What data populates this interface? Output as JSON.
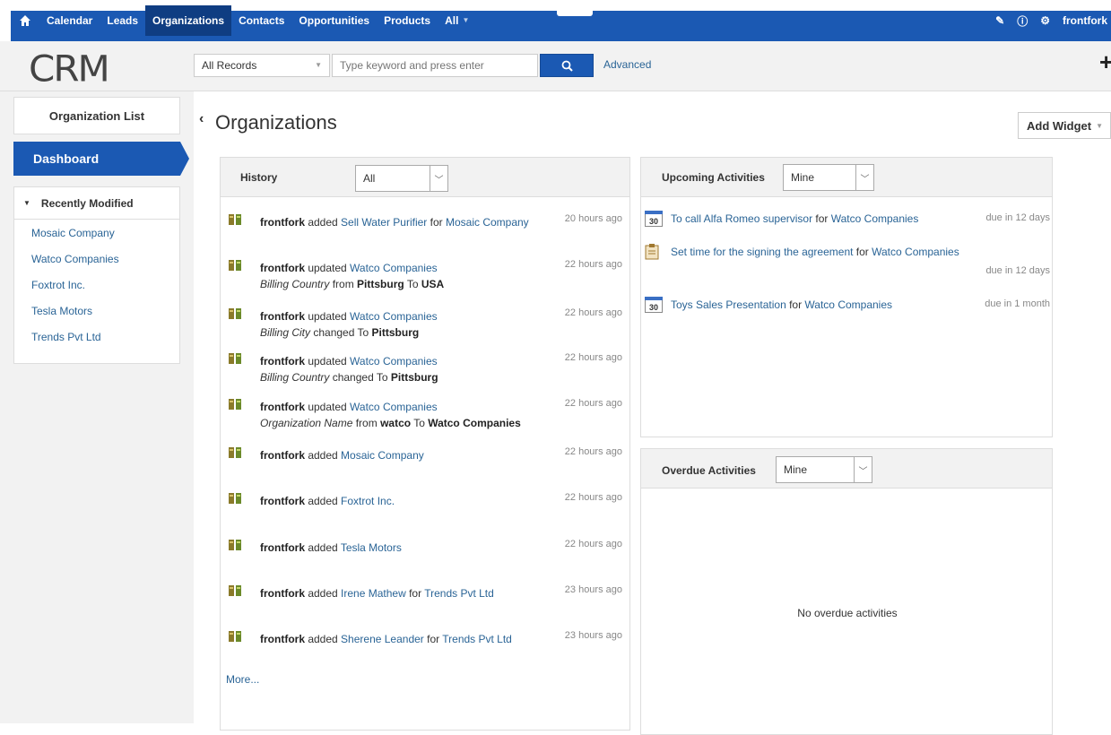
{
  "nav": {
    "items": [
      "Calendar",
      "Leads",
      "Organizations",
      "Contacts",
      "Opportunities",
      "Products",
      "All"
    ],
    "active": "Organizations",
    "user": "frontfork"
  },
  "header": {
    "logo": "CRM",
    "records_select": "All Records",
    "search_placeholder": "Type keyword and press enter",
    "advanced": "Advanced"
  },
  "sidebar": {
    "org_list": "Organization List",
    "dashboard": "Dashboard",
    "recent_title": "Recently Modified",
    "recent_items": [
      "Mosaic Company",
      "Watco Companies",
      "Foxtrot Inc.",
      "Tesla Motors",
      "Trends Pvt Ltd"
    ]
  },
  "page": {
    "title": "Organizations",
    "add_widget": "Add Widget"
  },
  "history": {
    "title": "History",
    "filter": "All",
    "more": "More...",
    "rows": [
      {
        "user": "frontfork",
        "action": "added",
        "link": "Sell Water Purifier",
        "for": "for",
        "target": "Mosaic Company",
        "time": "20 hours ago"
      },
      {
        "user": "frontfork",
        "action": "updated",
        "link": "Watco Companies",
        "field": "Billing Country",
        "mid": "from",
        "from": "Pittsburg",
        "to_word": "To",
        "to": "USA",
        "time": "22 hours ago"
      },
      {
        "user": "frontfork",
        "action": "updated",
        "link": "Watco Companies",
        "field": "Billing City",
        "mid": "changed To",
        "to": "Pittsburg",
        "time": "22 hours ago"
      },
      {
        "user": "frontfork",
        "action": "updated",
        "link": "Watco Companies",
        "field": "Billing Country",
        "mid": "changed To",
        "to": "Pittsburg",
        "time": "22 hours ago"
      },
      {
        "user": "frontfork",
        "action": "updated",
        "link": "Watco Companies",
        "field": "Organization Name",
        "mid": "from",
        "from": "watco",
        "to_word": "To",
        "to": "Watco Companies",
        "time": "22 hours ago"
      },
      {
        "user": "frontfork",
        "action": "added",
        "link": "Mosaic Company",
        "time": "22 hours ago"
      },
      {
        "user": "frontfork",
        "action": "added",
        "link": "Foxtrot Inc.",
        "time": "22 hours ago"
      },
      {
        "user": "frontfork",
        "action": "added",
        "link": "Tesla Motors",
        "time": "22 hours ago"
      },
      {
        "user": "frontfork",
        "action": "added",
        "link": "Irene Mathew",
        "for": "for",
        "target": "Trends Pvt Ltd",
        "time": "23 hours ago"
      },
      {
        "user": "frontfork",
        "action": "added",
        "link": "Sherene Leander",
        "for": "for",
        "target": "Trends Pvt Ltd",
        "time": "23 hours ago"
      }
    ]
  },
  "upcoming": {
    "title": "Upcoming Activities",
    "filter": "Mine",
    "items": [
      {
        "icon": "calendar-icon",
        "cal_day": "30",
        "text": "To call Alfa Romeo supervisor",
        "for": "for",
        "target": "Watco Companies",
        "due": "due in 12 days"
      },
      {
        "icon": "task-icon",
        "text": "Set time for the signing the agreement",
        "for": "for",
        "target": "Watco Companies",
        "due": "due in 12 days"
      },
      {
        "icon": "calendar-icon",
        "cal_day": "30",
        "text": "Toys Sales Presentation",
        "for": "for",
        "target": "Watco Companies",
        "due": "due in 1 month"
      }
    ]
  },
  "overdue": {
    "title": "Overdue Activities",
    "filter": "Mine",
    "empty": "No overdue activities"
  }
}
